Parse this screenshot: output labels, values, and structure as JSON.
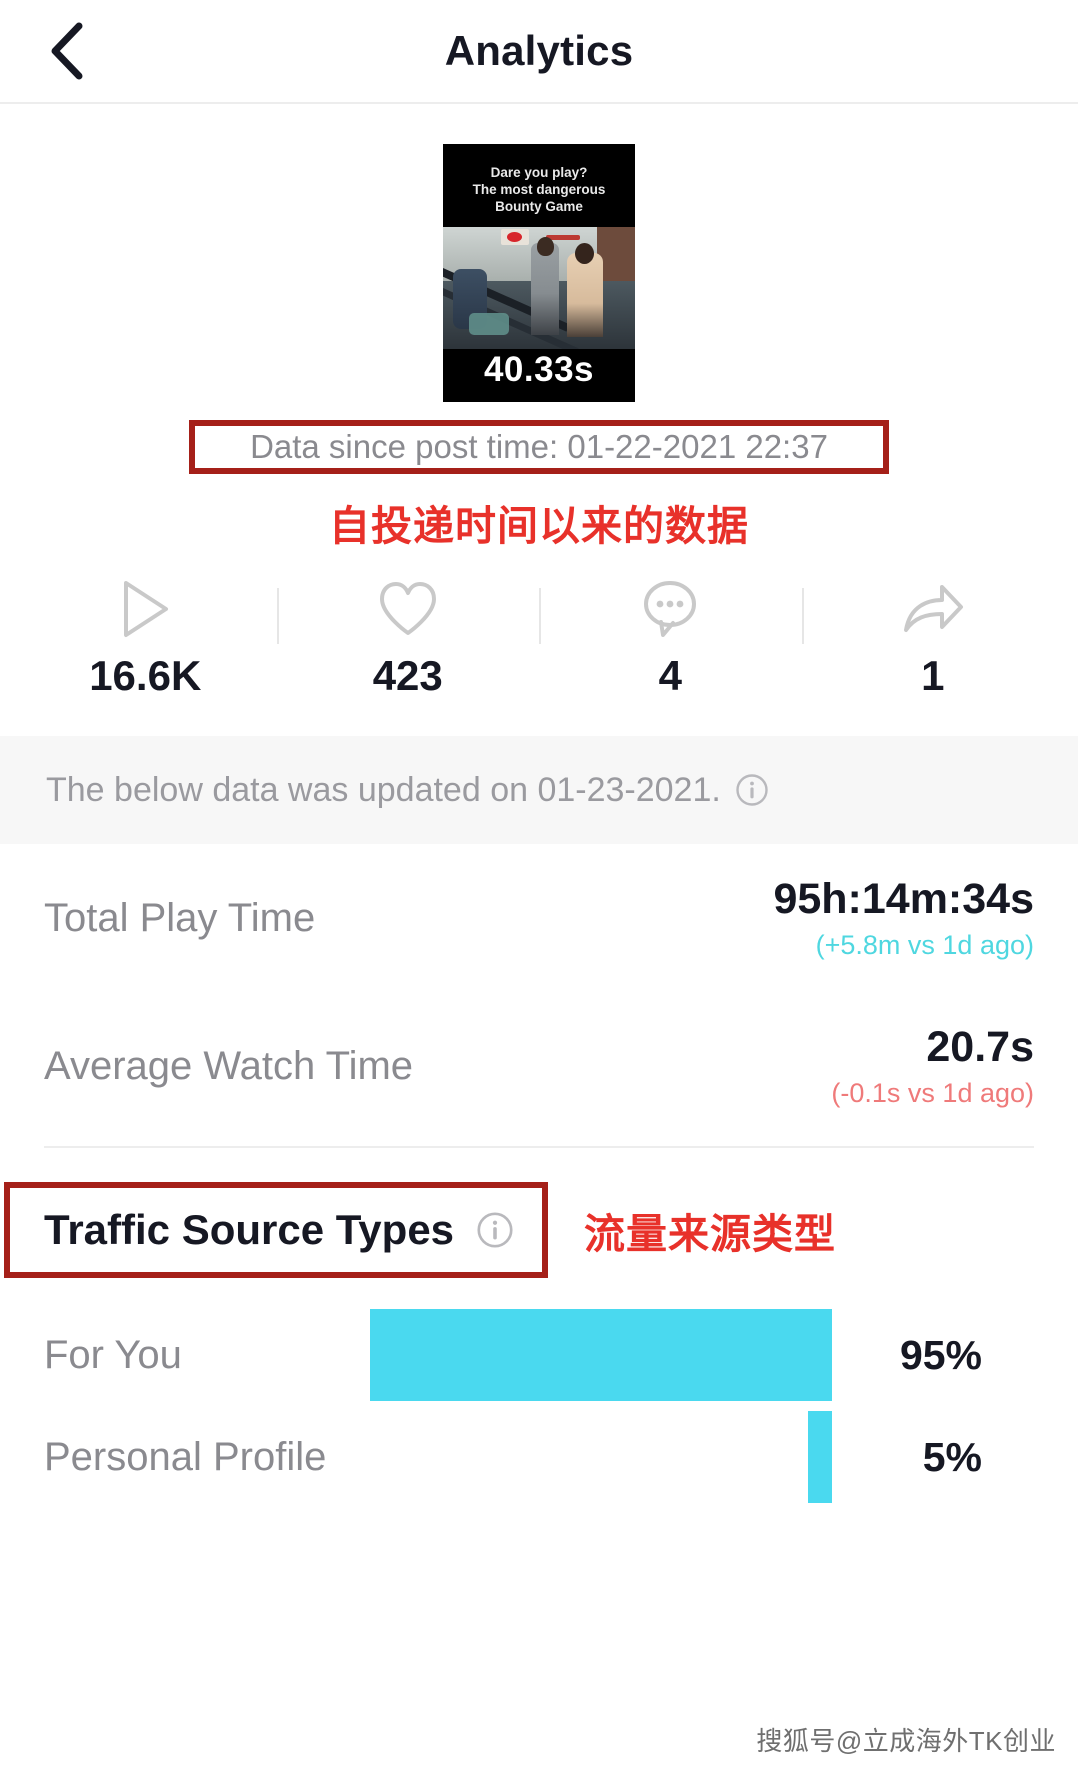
{
  "header": {
    "title": "Analytics",
    "back_icon": "chevron-left-icon"
  },
  "video": {
    "caption": "Dare you play?\nThe most dangerous\nBounty Game",
    "duration": "40.33s"
  },
  "since": {
    "text": "Data since post time: 01-22-2021 22:37",
    "annotation_cn": "自投递时间以来的数据",
    "annotation_color": "#e8312a",
    "box_color": "#a52019"
  },
  "stats": [
    {
      "icon": "play-icon",
      "value": "16.6K"
    },
    {
      "icon": "heart-icon",
      "value": "423"
    },
    {
      "icon": "comment-icon",
      "value": "4"
    },
    {
      "icon": "share-icon",
      "value": "1"
    }
  ],
  "updated": {
    "text": "The below data was updated on 01-23-2021.",
    "info_icon": "info-icon"
  },
  "metrics": [
    {
      "label": "Total Play Time",
      "value": "95h:14m:34s",
      "delta": "(+5.8m vs 1d ago)",
      "delta_direction": "up",
      "delta_color": "#4fd7e0"
    },
    {
      "label": "Average Watch Time",
      "value": "20.7s",
      "delta": "(-0.1s vs 1d ago)",
      "delta_direction": "down",
      "delta_color": "#ef7a7a"
    }
  ],
  "traffic": {
    "title": "Traffic Source Types",
    "info_icon": "info-icon",
    "annotation_cn": "流量来源类型",
    "bar_color": "#4ad9ef"
  },
  "chart_data": {
    "type": "bar",
    "title": "Traffic Source Types",
    "categories": [
      "For You",
      "Personal Profile"
    ],
    "values": [
      95,
      5
    ],
    "value_labels": [
      "95%",
      "5%"
    ],
    "xlabel": "",
    "ylabel": "",
    "xlim": [
      0,
      100
    ],
    "orientation": "horizontal",
    "grid": false,
    "legend": "none",
    "series_color": "#4ad9ef"
  },
  "watermark": "搜狐号@立成海外TK创业"
}
